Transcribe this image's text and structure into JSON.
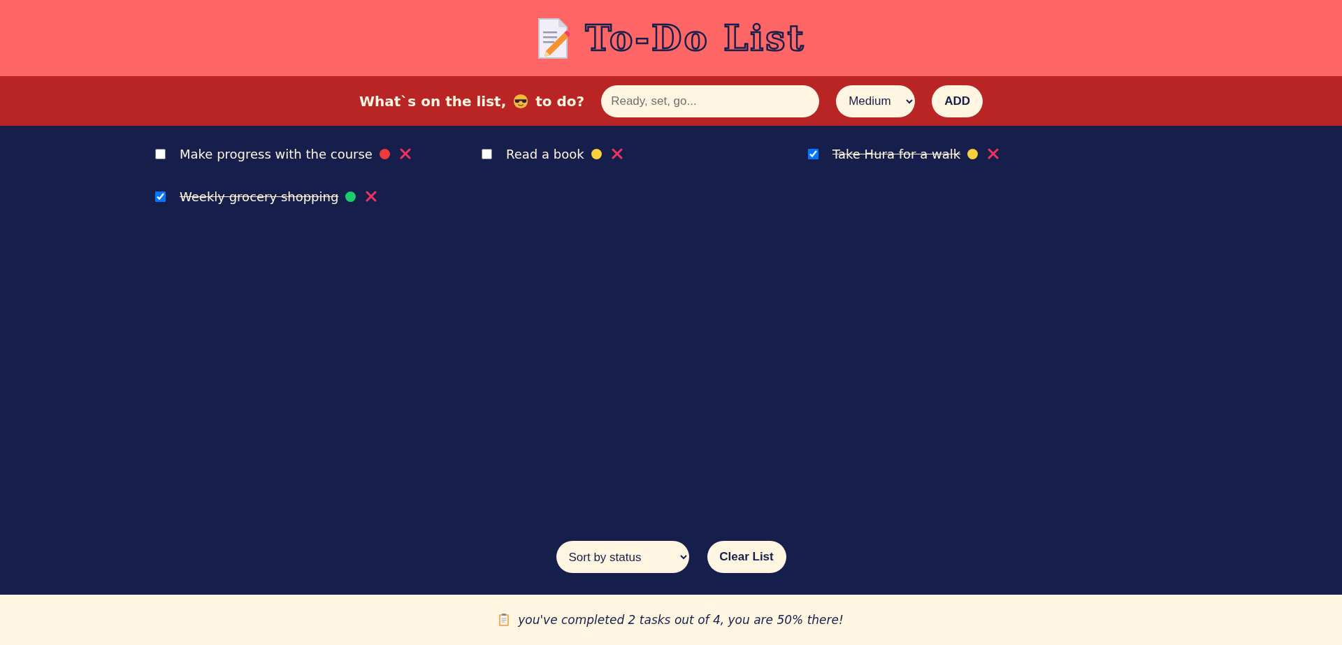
{
  "header": {
    "title": "To-Do List"
  },
  "form": {
    "prompt_before": "What`s on the list,",
    "prompt_after": "to do?",
    "input": {
      "placeholder": "Ready, set, go..."
    },
    "priority": {
      "value": "Medium"
    },
    "add_button": "ADD"
  },
  "tasks": [
    {
      "text": "Make progress with the course",
      "checked": false,
      "color": "#ee3a3a"
    },
    {
      "text": "Read a book",
      "checked": false,
      "color": "#f7d23e"
    },
    {
      "text": "Take Hura for a walk",
      "checked": true,
      "color": "#f7d23e"
    },
    {
      "text": "Weekly grocery shopping",
      "checked": true,
      "color": "#1ccc6a"
    }
  ],
  "controls": {
    "sort": {
      "value": "Sort by status"
    },
    "clear_button": "Clear List"
  },
  "footer": {
    "text": "you've completed 2 tasks out of 4, you are 50% there!"
  }
}
